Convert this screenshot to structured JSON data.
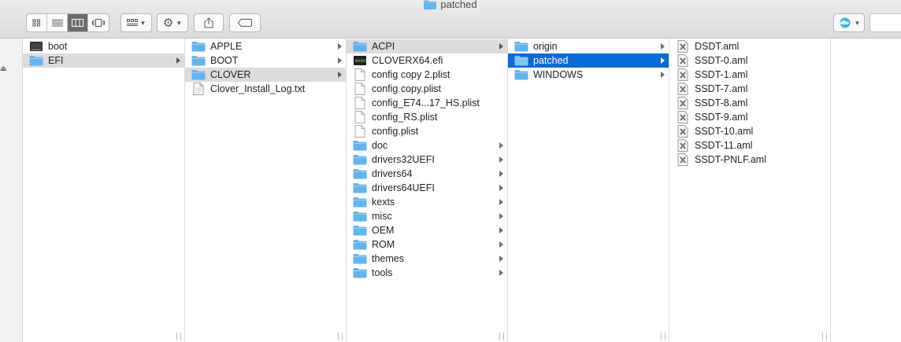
{
  "window": {
    "title": "patched"
  },
  "toolbar": {
    "view_buttons": [
      "icon-view-icon",
      "list-view-icon",
      "column-view-icon",
      "cover-flow-icon"
    ],
    "arrange_icon": "arrange-grid-icon",
    "action_icon": "gear-icon",
    "share_icon": "share-icon",
    "tag_icon": "tag-icon",
    "cloud_icon": "cloud-icon"
  },
  "colors": {
    "folder": "#5eb5f2",
    "selection_active": "#0a6bd6",
    "selection_inactive": "#dcdcdc"
  },
  "columns": [
    {
      "items": [
        {
          "label": "boot",
          "icon": "drive-icon",
          "has_children": false,
          "selected": ""
        },
        {
          "label": "EFI",
          "icon": "folder-icon",
          "has_children": true,
          "selected": "gray"
        }
      ]
    },
    {
      "items": [
        {
          "label": "APPLE",
          "icon": "folder-icon",
          "has_children": true,
          "selected": ""
        },
        {
          "label": "BOOT",
          "icon": "folder-icon",
          "has_children": true,
          "selected": ""
        },
        {
          "label": "CLOVER",
          "icon": "folder-icon",
          "has_children": true,
          "selected": "gray"
        },
        {
          "label": "Clover_Install_Log.txt",
          "icon": "text-file-icon",
          "has_children": false,
          "selected": ""
        }
      ]
    },
    {
      "items": [
        {
          "label": "ACPI",
          "icon": "folder-icon",
          "has_children": true,
          "selected": "gray"
        },
        {
          "label": "CLOVERX64.efi",
          "icon": "executable-icon",
          "has_children": false,
          "selected": ""
        },
        {
          "label": "config copy 2.plist",
          "icon": "document-icon",
          "has_children": false,
          "selected": ""
        },
        {
          "label": "config copy.plist",
          "icon": "document-icon",
          "has_children": false,
          "selected": ""
        },
        {
          "label": "config_E74...17_HS.plist",
          "icon": "document-icon",
          "has_children": false,
          "selected": ""
        },
        {
          "label": "config_RS.plist",
          "icon": "document-icon",
          "has_children": false,
          "selected": ""
        },
        {
          "label": "config.plist",
          "icon": "document-icon",
          "has_children": false,
          "selected": ""
        },
        {
          "label": "doc",
          "icon": "folder-icon",
          "has_children": true,
          "selected": ""
        },
        {
          "label": "drivers32UEFI",
          "icon": "folder-icon",
          "has_children": true,
          "selected": ""
        },
        {
          "label": "drivers64",
          "icon": "folder-icon",
          "has_children": true,
          "selected": ""
        },
        {
          "label": "drivers64UEFI",
          "icon": "folder-icon",
          "has_children": true,
          "selected": ""
        },
        {
          "label": "kexts",
          "icon": "folder-icon",
          "has_children": true,
          "selected": ""
        },
        {
          "label": "misc",
          "icon": "folder-icon",
          "has_children": true,
          "selected": ""
        },
        {
          "label": "OEM",
          "icon": "folder-icon",
          "has_children": true,
          "selected": ""
        },
        {
          "label": "ROM",
          "icon": "folder-icon",
          "has_children": true,
          "selected": ""
        },
        {
          "label": "themes",
          "icon": "folder-icon",
          "has_children": true,
          "selected": ""
        },
        {
          "label": "tools",
          "icon": "folder-icon",
          "has_children": true,
          "selected": ""
        }
      ]
    },
    {
      "items": [
        {
          "label": "origin",
          "icon": "folder-icon",
          "has_children": true,
          "selected": ""
        },
        {
          "label": "patched",
          "icon": "folder-icon",
          "has_children": true,
          "selected": "blue"
        },
        {
          "label": "WINDOWS",
          "icon": "folder-icon",
          "has_children": true,
          "selected": ""
        }
      ]
    },
    {
      "items": [
        {
          "label": "DSDT.aml",
          "icon": "aml-file-icon",
          "has_children": false,
          "selected": ""
        },
        {
          "label": "SSDT-0.aml",
          "icon": "aml-file-icon",
          "has_children": false,
          "selected": ""
        },
        {
          "label": "SSDT-1.aml",
          "icon": "aml-file-icon",
          "has_children": false,
          "selected": ""
        },
        {
          "label": "SSDT-7.aml",
          "icon": "aml-file-icon",
          "has_children": false,
          "selected": ""
        },
        {
          "label": "SSDT-8.aml",
          "icon": "aml-file-icon",
          "has_children": false,
          "selected": ""
        },
        {
          "label": "SSDT-9.aml",
          "icon": "aml-file-icon",
          "has_children": false,
          "selected": ""
        },
        {
          "label": "SSDT-10.aml",
          "icon": "aml-file-icon",
          "has_children": false,
          "selected": ""
        },
        {
          "label": "SSDT-11.aml",
          "icon": "aml-file-icon",
          "has_children": false,
          "selected": ""
        },
        {
          "label": "SSDT-PNLF.aml",
          "icon": "aml-file-icon",
          "has_children": false,
          "selected": ""
        }
      ]
    }
  ]
}
